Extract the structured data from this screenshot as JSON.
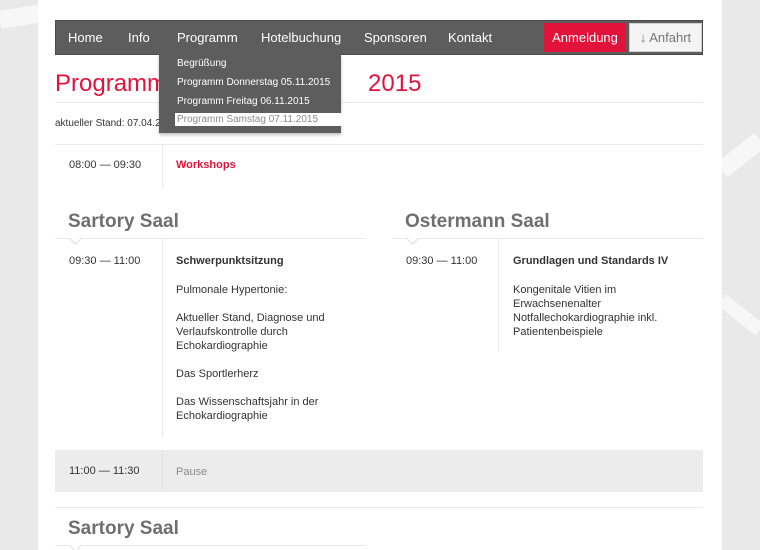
{
  "nav": {
    "items": [
      {
        "label": "Home"
      },
      {
        "label": "Info"
      },
      {
        "label": "Programm"
      },
      {
        "label": "Hotelbuchung"
      },
      {
        "label": "Sponsoren"
      },
      {
        "label": "Kontakt"
      }
    ],
    "anmeldung_label": "Anmeldung",
    "anfahrt_label": "↓ Anfahrt"
  },
  "dropdown": {
    "items": [
      {
        "label": "Begrüßung"
      },
      {
        "label": "Programm Donnerstag 05.11.2015"
      },
      {
        "label": "Programm Freitag 06.11.2015"
      },
      {
        "label": "Programm Samstag 07.11.2015"
      }
    ]
  },
  "page": {
    "title_start": "Programm",
    "title_end": "2015",
    "stand": "aktueller Stand: 07.04.2"
  },
  "schedule": {
    "workshops": {
      "time": "08:00 — 09:30",
      "title": "Workshops"
    },
    "sartory": {
      "room": "Sartory Saal",
      "time": "09:30 — 11:00",
      "title": "Schwerpunktsitzung",
      "lines": [
        "Pulmonale Hypertonie:",
        "Aktueller Stand, Diagnose und",
        "Verlaufskontrolle durch",
        "Echokardiographie",
        "Das Sportlerherz",
        "Das Wissenschaftsjahr in der",
        "Echokardiographie"
      ]
    },
    "ostermann": {
      "room": "Ostermann Saal",
      "time": "09:30 — 11:00",
      "title": "Grundlagen und Standards IV",
      "lines": [
        "Kongenitale Vitien im",
        "Erwachsenenalter",
        "Notfallechokardiographie inkl.",
        "Patientenbeispiele"
      ]
    },
    "pause": {
      "time": "11:00 — 11:30",
      "label": "Pause"
    },
    "sartory2": {
      "room": "Sartory Saal"
    }
  },
  "colors": {
    "accent": "#e2133b",
    "nav_bg": "#5d5d5d",
    "background": "#e9e9e9"
  }
}
